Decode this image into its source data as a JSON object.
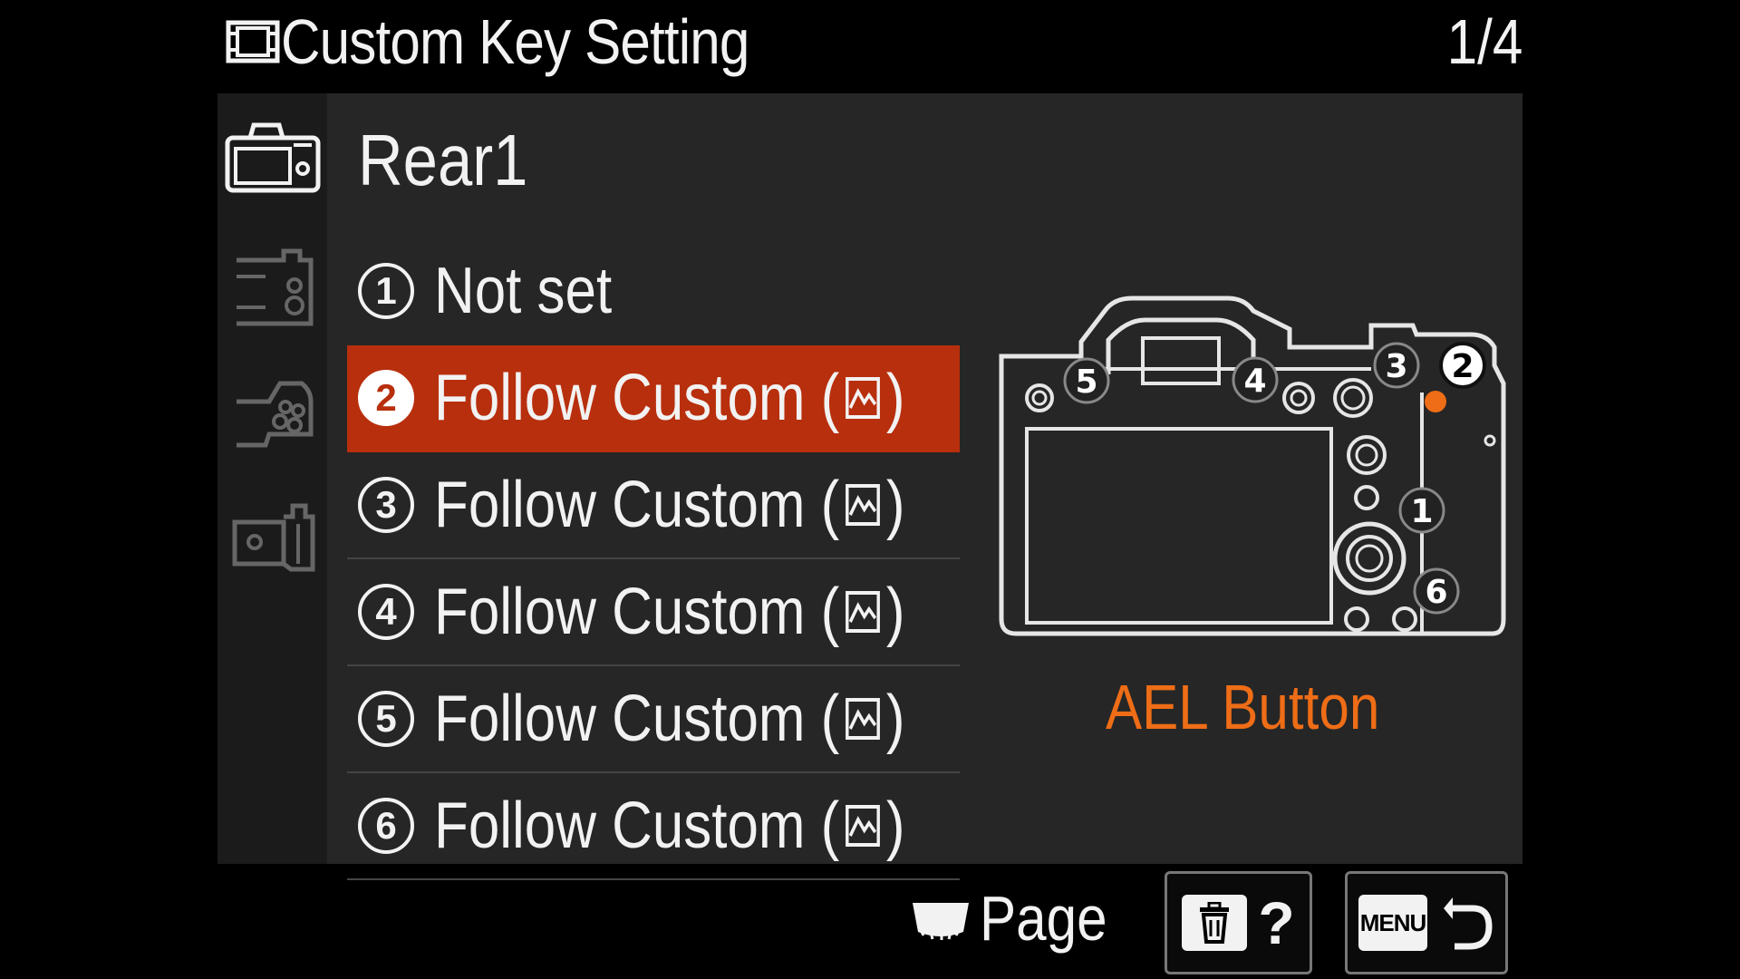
{
  "header": {
    "title": "Custom Key Setting",
    "page_indicator": "1/4",
    "icon": "movie-frame-icon"
  },
  "sidebar": {
    "tabs": [
      {
        "icon": "camera-rear-icon",
        "selected": true
      },
      {
        "icon": "camera-side-icon",
        "selected": false
      },
      {
        "icon": "camera-grip-icon",
        "selected": false
      },
      {
        "icon": "camera-front-lens-icon",
        "selected": false
      }
    ]
  },
  "section": {
    "title": "Rear1"
  },
  "menu": {
    "items": [
      {
        "number": "1",
        "label": "Not set",
        "has_icon": false,
        "selected": false
      },
      {
        "number": "2",
        "label": "Follow Custom (",
        "suffix": ")",
        "has_icon": true,
        "selected": true
      },
      {
        "number": "3",
        "label": "Follow Custom (",
        "suffix": ")",
        "has_icon": true,
        "selected": false
      },
      {
        "number": "4",
        "label": "Follow Custom (",
        "suffix": ")",
        "has_icon": true,
        "selected": false
      },
      {
        "number": "5",
        "label": "Follow Custom (",
        "suffix": ")",
        "has_icon": true,
        "selected": false
      },
      {
        "number": "6",
        "label": "Follow Custom (",
        "suffix": ")",
        "has_icon": true,
        "selected": false
      }
    ]
  },
  "camera_diagram": {
    "button_numbers": [
      "1",
      "2",
      "3",
      "4",
      "5",
      "6"
    ],
    "highlighted_button": "2",
    "button_name": "AEL Button"
  },
  "footer": {
    "page_label": "Page",
    "help_button": {
      "icon": "trash-icon",
      "label": "?"
    },
    "back_button": {
      "key": "MENU",
      "icon": "return-arrow-icon"
    }
  },
  "colors": {
    "background": "#000000",
    "panel": "#262626",
    "selected": "#b82f0d",
    "accent_orange": "#ee6d16",
    "text": "#f2f2f2"
  }
}
